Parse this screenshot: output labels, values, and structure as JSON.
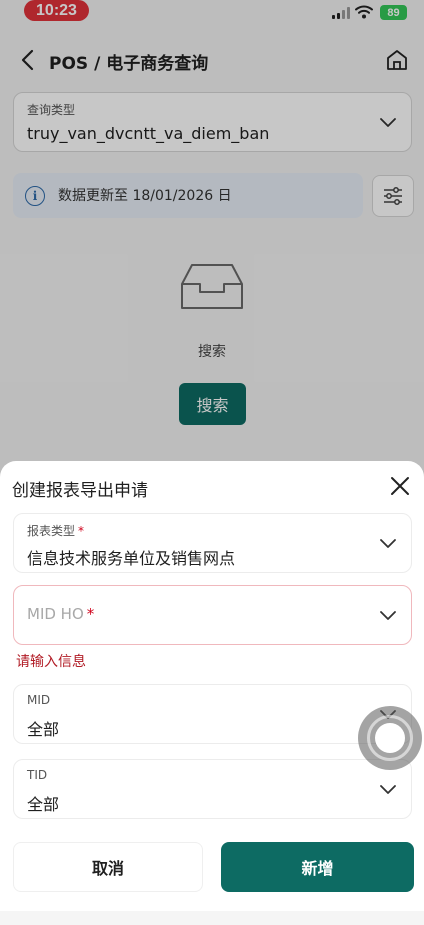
{
  "status_bar": {
    "time": "10:23",
    "battery": "89"
  },
  "header": {
    "title": "POS / 电子商务查询"
  },
  "query_type": {
    "label": "查询类型",
    "value": "truy_van_dvcntt_va_diem_ban"
  },
  "info": {
    "text": "数据更新至 18/01/2026 日"
  },
  "empty_state": {
    "text": "搜索"
  },
  "search_button": {
    "label": "搜索"
  },
  "sheet": {
    "title": "创建报表导出申请",
    "report_type": {
      "label": "报表类型",
      "value": "信息技术服务单位及销售网点",
      "required_mark": "*"
    },
    "mid_ho": {
      "placeholder": "MID HO",
      "required_mark": "*",
      "error": "请输入信息"
    },
    "mid": {
      "label": "MID",
      "value": "全部"
    },
    "tid": {
      "label": "TID",
      "value": "全部"
    },
    "cancel_label": "取消",
    "add_label": "新增"
  },
  "colors": {
    "primary": "#0d6b63",
    "error": "#b11b25",
    "time_pill": "#e1323a",
    "battery": "#34c759"
  }
}
